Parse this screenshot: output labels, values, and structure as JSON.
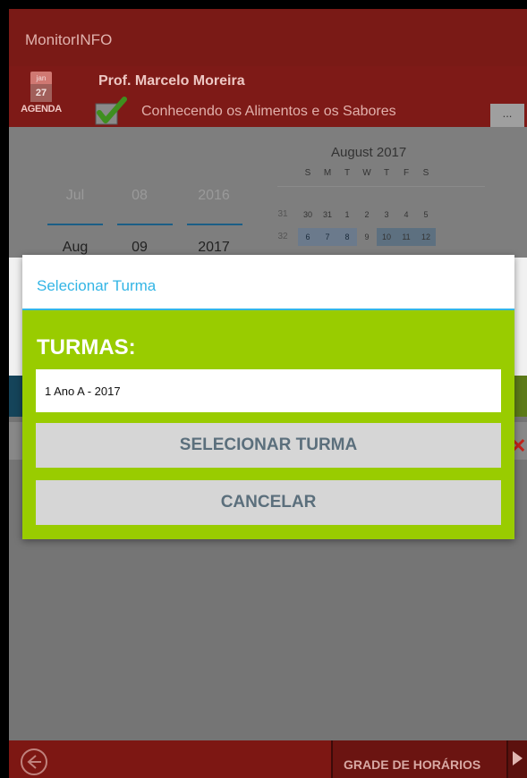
{
  "app": {
    "title": "MonitorINFO"
  },
  "header": {
    "teacher": "Prof. Marcelo Moreira",
    "subject": "Conhecendo os Alimentos e os Sabores",
    "agenda_label": "AGENDA",
    "agenda_month": "jan",
    "agenda_day": "27",
    "more_label": "..."
  },
  "date_picker": {
    "prev": {
      "month": "Jul",
      "day": "08",
      "year": "2016"
    },
    "current": {
      "month": "Aug",
      "day": "09",
      "year": "2017"
    }
  },
  "calendar": {
    "title": "August 2017",
    "weekdays": [
      "S",
      "M",
      "T",
      "W",
      "T",
      "F",
      "S"
    ],
    "weeks": [
      {
        "week": "31",
        "days": [
          "30",
          "31",
          "1",
          "2",
          "3",
          "4",
          "5"
        ]
      },
      {
        "week": "32",
        "days": [
          "6",
          "7",
          "8",
          "9",
          "10",
          "11",
          "12"
        ]
      }
    ]
  },
  "dialog": {
    "title": "Selecionar Turma",
    "turmas_label": "TURMAS:",
    "turma_value": "1 Ano A - 2017",
    "select_button": "SELECIONAR TURMA",
    "cancel_button": "CANCELAR"
  },
  "footer": {
    "grade_button": "GRADE DE HORÁRIOS"
  },
  "colors": {
    "header": "#7a1a16",
    "dialog_accent": "#33b5e5",
    "dialog_body": "#99cc00",
    "footer": "#7d1713"
  }
}
